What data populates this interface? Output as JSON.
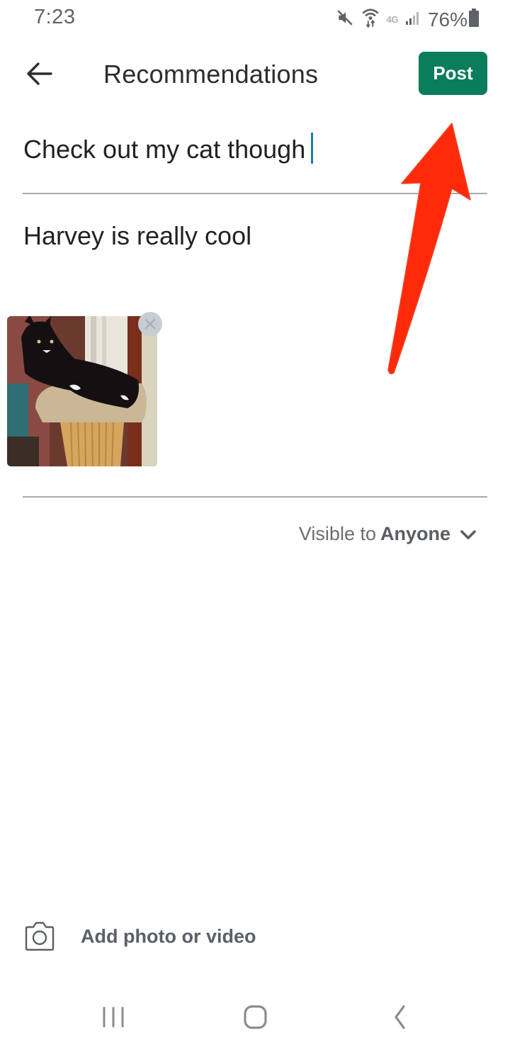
{
  "status_bar": {
    "time": "7:23",
    "network_label": "4G",
    "battery_percent": "76%",
    "icons": [
      "mute-icon",
      "wifi-icon",
      "lte-icon",
      "signal-icon",
      "battery-icon"
    ]
  },
  "app_bar": {
    "back_icon": "arrow-left-icon",
    "title": "Recommendations",
    "post_label": "Post",
    "accent_color": "#0a7d5a"
  },
  "composer": {
    "subject_value": "Check out my cat though",
    "body_value": "Harvey is really cool",
    "attachment": {
      "type": "photo",
      "description": "Black and white long-haired cat lying on a carpeted cat tree",
      "remove_icon": "close-icon"
    }
  },
  "visibility": {
    "prefix": "Visible to",
    "value": "Anyone",
    "icon": "chevron-down-icon"
  },
  "add_media": {
    "icon": "camera-icon",
    "label": "Add photo or video"
  },
  "nav_bar": {
    "recents_icon": "recents-icon",
    "home_icon": "home-icon",
    "back_icon": "back-icon"
  },
  "annotation": {
    "type": "arrow",
    "color": "#ff2a0a",
    "points_to": "post-button"
  }
}
